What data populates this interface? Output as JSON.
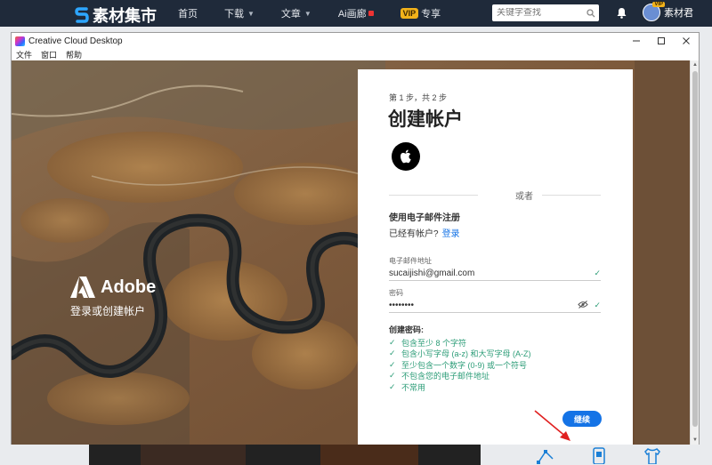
{
  "site": {
    "logo_text": "素材集市",
    "nav": [
      {
        "label": "首页",
        "has_caret": false
      },
      {
        "label": "下载",
        "has_caret": true
      },
      {
        "label": "文章",
        "has_caret": true
      },
      {
        "label": "Ai画廊",
        "has_caret": false
      },
      {
        "label": "专享",
        "has_caret": false
      }
    ],
    "vip_badge": "VIP",
    "search_placeholder": "关键字查找",
    "avatar_badge": "VIP",
    "username": "素材君"
  },
  "window": {
    "title": "Creative Cloud Desktop",
    "menu": [
      "文件",
      "窗口",
      "帮助"
    ]
  },
  "brand": {
    "name": "Adobe",
    "tagline": "登录或创建帐户"
  },
  "signup": {
    "step": "第 1 步，共 2 步",
    "title": "创建帐户",
    "or": "或者",
    "email_heading": "使用电子邮件注册",
    "have_account": "已经有帐户?",
    "login_link": "登录",
    "email_label": "电子邮件地址",
    "email_value": "sucaijishi@gmail.com",
    "password_label": "密码",
    "password_value": "••••••••",
    "rules_title": "创建密码:",
    "rules": [
      "包含至少 8 个字符",
      "包含小写字母 (a-z) 和大写字母 (A-Z)",
      "至少包含一个数字 (0-9) 或一个符号",
      "不包含您的电子邮件地址",
      "不常用"
    ],
    "continue": "继续"
  },
  "colors": {
    "accent": "#1473e6",
    "success": "#2d9d78",
    "nav_bg": "#1f2a3a",
    "annotation_arrow": "#e02020"
  }
}
